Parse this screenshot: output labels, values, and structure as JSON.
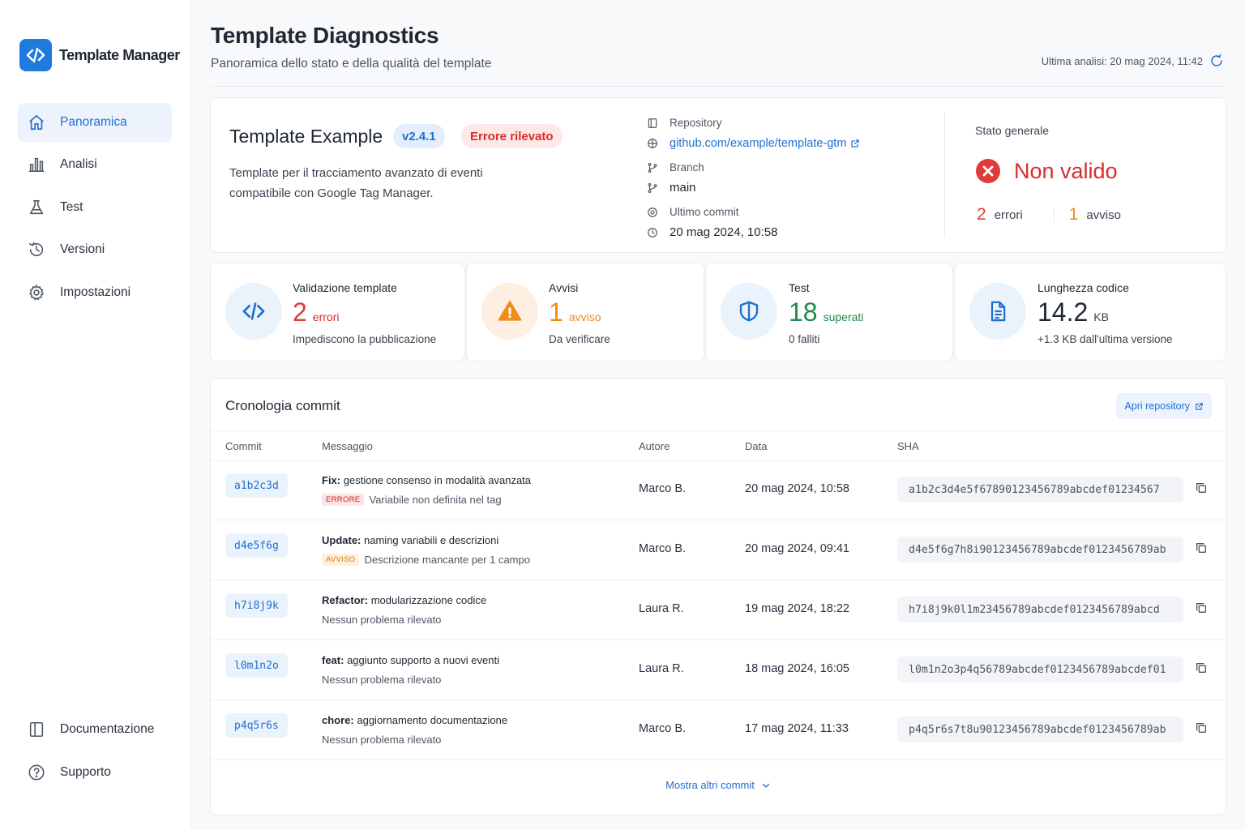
{
  "app": {
    "name": "Template Manager"
  },
  "sidebar": {
    "items": [
      {
        "label": "Panoramica",
        "icon": "home-icon",
        "active": true
      },
      {
        "label": "Analisi",
        "icon": "bar-chart-icon"
      },
      {
        "label": "Test",
        "icon": "flask-icon"
      },
      {
        "label": "Versioni",
        "icon": "history-icon"
      },
      {
        "label": "Impostazioni",
        "icon": "gear-icon"
      }
    ],
    "bottom": [
      {
        "label": "Documentazione",
        "icon": "book-icon"
      },
      {
        "label": "Supporto",
        "icon": "help-icon"
      }
    ]
  },
  "header": {
    "title": "Template Diagnostics",
    "subtitle": "Panoramica dello stato e della qualità del template",
    "last_analysis": "Ultima analisi: 20 mag 2024, 11:42"
  },
  "template": {
    "name": "Template Example",
    "version": "v2.4.1",
    "error_badge": "Errore rilevato",
    "description": "Template per il tracciamento avanzato di eventi compatibile con Google Tag Manager.",
    "repository_label": "Repository",
    "repository": "github.com/example/template-gtm",
    "branch_label": "Branch",
    "branch": "main",
    "last_commit_label": "Ultimo commit",
    "last_commit": "20 mag 2024, 10:58"
  },
  "status": {
    "label": "Stato generale",
    "value": "Non valido",
    "errors": "2",
    "errors_label": "errori",
    "warnings": "1",
    "warnings_label": "avviso"
  },
  "metrics": [
    {
      "title": "Validazione template",
      "value": "2",
      "unit": "errori",
      "sub": "Impediscono la pubblicazione",
      "icon": "code-icon",
      "color": "#e03b3b"
    },
    {
      "title": "Avvisi",
      "value": "1",
      "unit": "avviso",
      "sub": "Da verificare",
      "icon": "warning-icon",
      "color": "#f08c1a"
    },
    {
      "title": "Test",
      "value": "18",
      "unit": "superati",
      "sub": "0 falliti",
      "icon": "shield-icon",
      "color": "#1e8a4c"
    },
    {
      "title": "Lunghezza codice",
      "value": "14.2",
      "unit": "KB",
      "sub": "+1.3 KB dall'ultima versione",
      "icon": "document-icon",
      "color": "#1f2733"
    }
  ],
  "commits": {
    "title": "Cronologia commit",
    "open_repo": "Apri repository",
    "columns": [
      "Commit",
      "Messaggio",
      "Autore",
      "Data",
      "SHA"
    ],
    "rows": [
      {
        "id": "a1b2c3d",
        "type": "Fix:",
        "message": "gestione consenso in modalità avanzata",
        "tag": "ERRORE",
        "tag_kind": "err",
        "note": "Variabile non definita nel tag",
        "author": "Marco B.",
        "date": "20 mag 2024, 10:58",
        "sha": "a1b2c3d4e5f67890123456789abcdef01234567"
      },
      {
        "id": "d4e5f6g",
        "type": "Update:",
        "message": "naming variabili e descrizioni",
        "tag": "AVVISO",
        "tag_kind": "warn",
        "note": "Descrizione mancante per 1 campo",
        "author": "Marco B.",
        "date": "20 mag 2024, 09:41",
        "sha": "d4e5f6g7h8i90123456789abcdef0123456789ab"
      },
      {
        "id": "h7i8j9k",
        "type": "Refactor:",
        "message": "modularizzazione codice",
        "tag": "",
        "tag_kind": "",
        "note": "Nessun problema rilevato",
        "author": "Laura R.",
        "date": "19 mag 2024, 18:22",
        "sha": "h7i8j9k0l1m23456789abcdef0123456789abcd"
      },
      {
        "id": "l0m1n2o",
        "type": "feat:",
        "message": "aggiunto supporto a nuovi eventi",
        "tag": "",
        "tag_kind": "",
        "note": "Nessun problema rilevato",
        "author": "Laura R.",
        "date": "18 mag 2024, 16:05",
        "sha": "l0m1n2o3p4q56789abcdef0123456789abcdef01"
      },
      {
        "id": "p4q5r6s",
        "type": "chore:",
        "message": "aggiornamento documentazione",
        "tag": "",
        "tag_kind": "",
        "note": "Nessun problema rilevato",
        "author": "Marco B.",
        "date": "17 mag 2024, 11:33",
        "sha": "p4q5r6s7t8u90123456789abcdef0123456789ab"
      }
    ],
    "show_more": "Mostra altri commit"
  },
  "colors": {
    "accent": "#1f6fd1",
    "error": "#e03b3b",
    "warning": "#f08c1a",
    "success": "#1e8a4c"
  }
}
